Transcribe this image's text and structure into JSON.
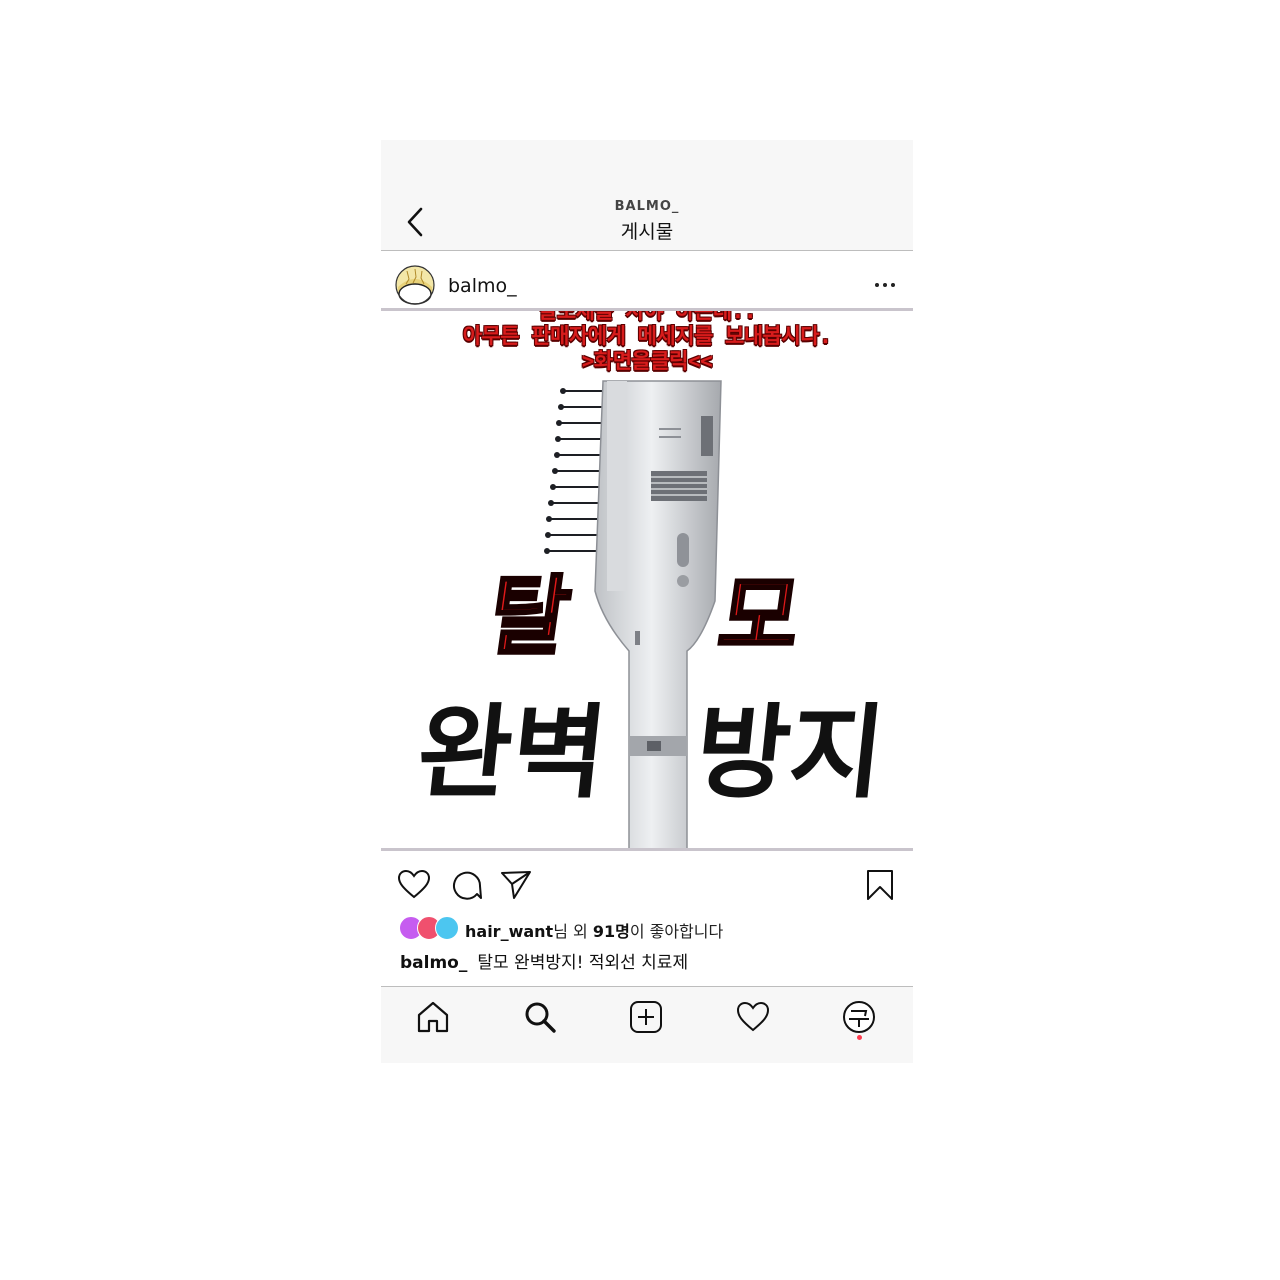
{
  "header": {
    "account": "BALMO_",
    "title": "게시물"
  },
  "post": {
    "username": "balmo_",
    "overlay_lines": [
      "발모제를 사야 하는데..",
      "아무튼 판매자에게 메세지를 보내봅시다.",
      ">화면을클릭<<"
    ],
    "headline_red": [
      "탈",
      "모"
    ],
    "headline_black": [
      "완벽",
      "방지"
    ],
    "likes": {
      "user": "hair_want",
      "mid": "님 외 ",
      "count": "91명",
      "suffix": "이 좋아합니다"
    },
    "caption": {
      "user": "balmo_",
      "text": "탈모 완벽방지! 적외선 치료제"
    }
  },
  "icons": {
    "header": [
      "back-arrow-icon",
      "more-options-icon"
    ],
    "actions": [
      "heart-icon",
      "comment-icon",
      "send-icon",
      "bookmark-icon"
    ],
    "tabs": [
      "home-icon",
      "search-icon",
      "add-post-icon",
      "activity-heart-icon",
      "profile-icon"
    ]
  },
  "colors": {
    "overlay_text": "#d81c1c",
    "headline_red": "#e01919",
    "like_dot_1": "#c65cf0",
    "like_dot_2": "#f0506e",
    "like_dot_3": "#4cc6f0",
    "notification": "#ff3b4e"
  }
}
